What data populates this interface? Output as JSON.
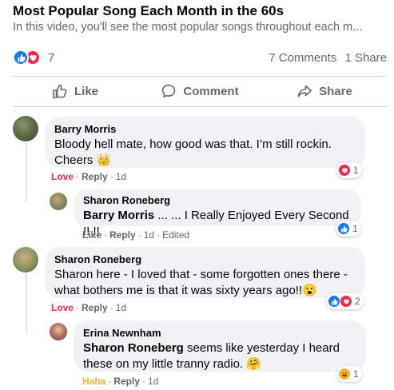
{
  "post": {
    "title": "Most Popular Song Each Month in the 60s",
    "subtitle": "In this video, you'll see the most popular songs throughout each m...",
    "reaction_count": "7",
    "comments_count": "7 Comments",
    "shares_count": "1 Share"
  },
  "actions": {
    "like": "Like",
    "comment": "Comment",
    "share": "Share"
  },
  "comments": [
    {
      "author": "Barry Morris",
      "text": "Bloody hell mate, how good was that. I’m still rockin. Cheers 👑",
      "reaction_label": "Love",
      "reply": "Reply",
      "time": "1d",
      "reactions": "1"
    },
    {
      "author": "Sharon Roneberg",
      "mention": "Barry Morris",
      "text": " ... ... I Really Enjoyed Every Second !! !!",
      "reaction_label": "Like",
      "reply": "Reply",
      "time": "1d",
      "edited": "Edited",
      "reactions": "1"
    },
    {
      "author": "Sharon Roneberg",
      "text": "Sharon here - I loved that - some forgotten ones there - what bothers me is that it was sixty years ago!!😮",
      "reaction_label": "Love",
      "reply": "Reply",
      "time": "1d",
      "reactions": "2"
    },
    {
      "author": "Erina Newnham",
      "mention": "Sharon Roneberg",
      "text": " seems like yesterday I heard these on my little tranny radio. 🤗",
      "reaction_label": "Haha",
      "reply": "Reply",
      "time": "1d",
      "reactions": "1"
    }
  ],
  "colors": {
    "like": "#1877f2",
    "love": "#f02849",
    "haha": "#f7b125",
    "muted": "#65676b",
    "bubble": "#f0f2f5"
  }
}
